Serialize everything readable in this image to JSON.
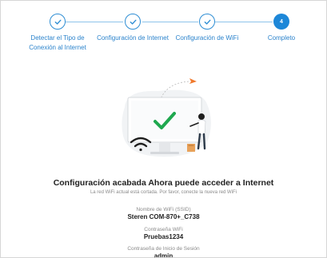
{
  "stepper": {
    "steps": [
      {
        "label": "Detectar el Tipo de Conexión al Internet",
        "state": "done",
        "icon": "check-icon"
      },
      {
        "label": "Configuración de Internet",
        "state": "done",
        "icon": "check-icon"
      },
      {
        "label": "Configuración de WiFi",
        "state": "done",
        "icon": "check-icon"
      },
      {
        "label": "Completo",
        "state": "active",
        "number": "4"
      }
    ],
    "accent_color": "#1d87d8"
  },
  "result": {
    "title": "Configuración acabada Ahora puede acceder a Internet",
    "subtitle": "La red WiFi actual está cortada. Por favor, conecte la nueva red WiFi"
  },
  "details": {
    "ssid_label": "Nombre de WiFi (SSID)",
    "ssid_value": "Steren COM-870+_C738",
    "password_label": "Contraseña WiFi",
    "password_value": "Pruebas1234",
    "login_label": "Contraseña de Inicio de Sesión",
    "login_value": "admin"
  },
  "illustration": {
    "icons": [
      "monitor-icon",
      "checkmark-icon",
      "wifi-icon",
      "paper-plane-icon",
      "person-figure"
    ],
    "check_color": "#1fa84f"
  }
}
